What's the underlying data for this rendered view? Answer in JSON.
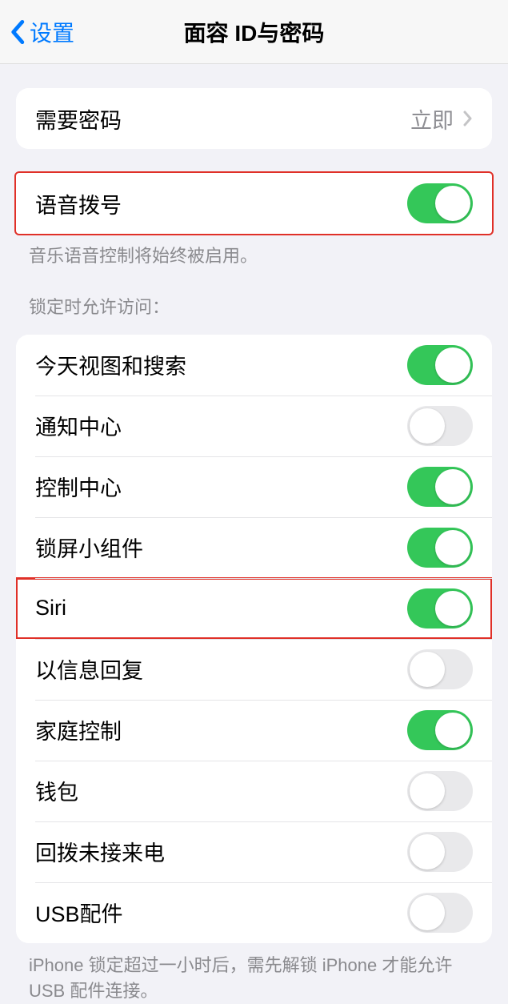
{
  "header": {
    "back_label": "设置",
    "title": "面容 ID与密码"
  },
  "passcode": {
    "label": "需要密码",
    "value": "立即"
  },
  "voice_dial": {
    "label": "语音拨号",
    "on": true,
    "footer": "音乐语音控制将始终被启用。"
  },
  "lock_access": {
    "header": "锁定时允许访问：",
    "items": [
      {
        "label": "今天视图和搜索",
        "on": true
      },
      {
        "label": "通知中心",
        "on": false
      },
      {
        "label": "控制中心",
        "on": true
      },
      {
        "label": "锁屏小组件",
        "on": true
      },
      {
        "label": "Siri",
        "on": true
      },
      {
        "label": "以信息回复",
        "on": false
      },
      {
        "label": "家庭控制",
        "on": true
      },
      {
        "label": "钱包",
        "on": false
      },
      {
        "label": "回拨未接来电",
        "on": false
      },
      {
        "label": "USB配件",
        "on": false
      }
    ],
    "footer": "iPhone 锁定超过一小时后，需先解锁 iPhone 才能允许USB 配件连接。"
  }
}
